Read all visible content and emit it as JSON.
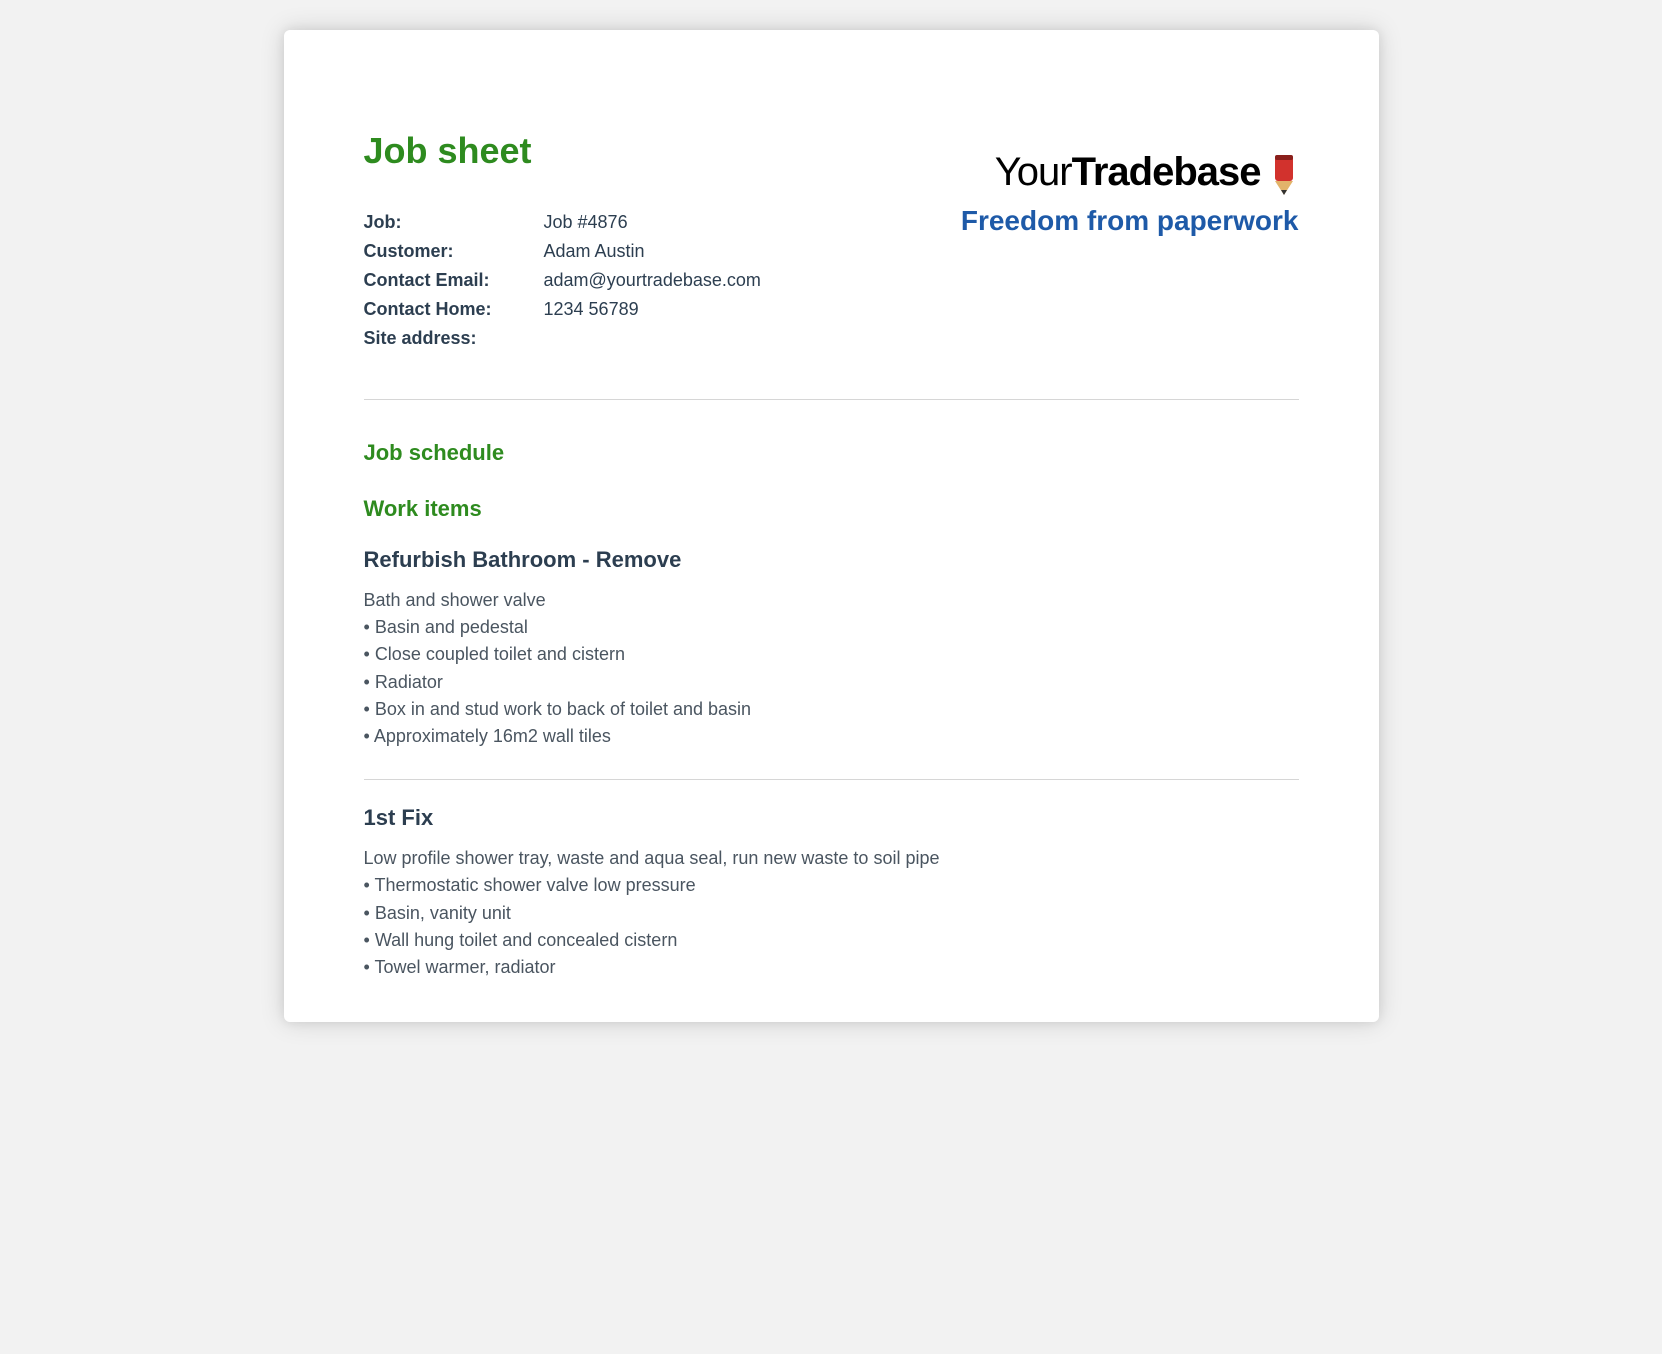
{
  "page_title": "Job sheet",
  "brand": {
    "name_thin": "Your",
    "name_bold": "Tradebase",
    "tagline": "Freedom from paperwork"
  },
  "details": {
    "job_label": "Job:",
    "job_value": "Job #4876",
    "customer_label": "Customer:",
    "customer_value": "Adam Austin",
    "email_label": "Contact Email:",
    "email_value": "adam@yourtradebase.com",
    "home_label": "Contact Home:",
    "home_value": "1234 56789",
    "site_label": "Site address:",
    "site_value": ""
  },
  "schedule_heading": "Job schedule",
  "work_items_heading": "Work items",
  "work_items": [
    {
      "title": "Refurbish Bathroom - Remove",
      "intro": "Bath and shower valve",
      "bullets": [
        "Basin and pedestal",
        "Close coupled toilet and cistern",
        "Radiator",
        "Box in and stud work to back of toilet and basin",
        "Approximately 16m2 wall tiles"
      ]
    },
    {
      "title": "1st Fix",
      "intro": "Low profile shower tray, waste and aqua seal, run new waste to soil pipe",
      "bullets": [
        "Thermostatic shower valve low pressure",
        "Basin, vanity unit",
        "Wall hung toilet and concealed cistern",
        "Towel warmer, radiator"
      ]
    }
  ]
}
